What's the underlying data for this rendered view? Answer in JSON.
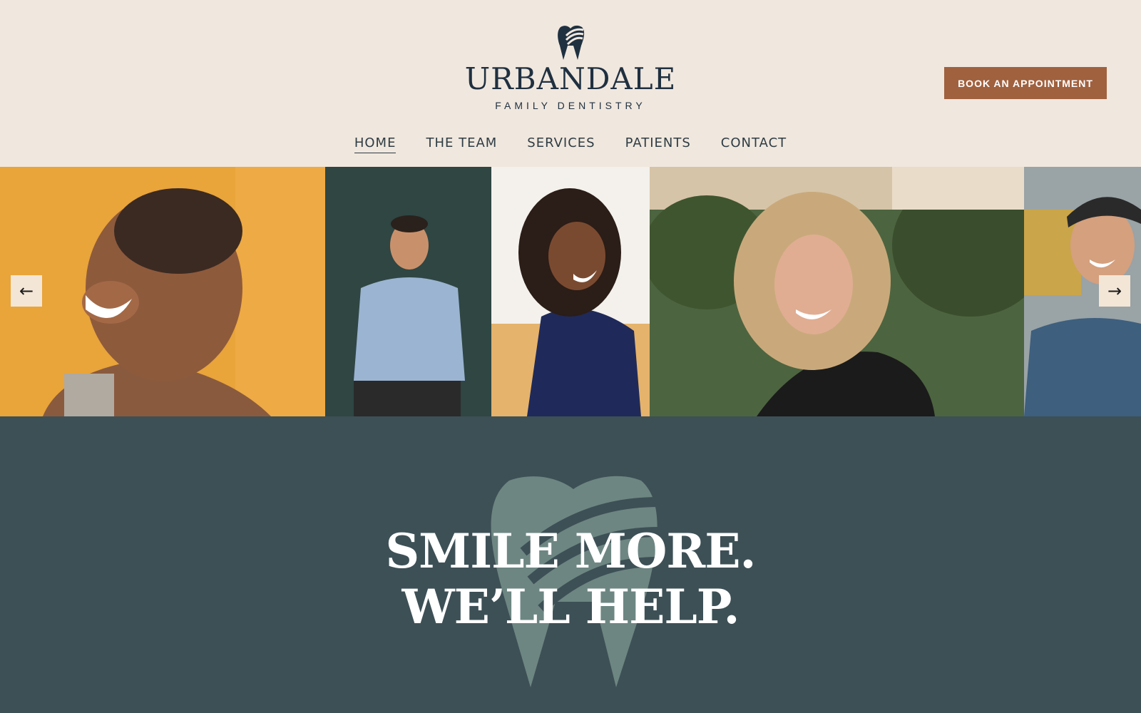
{
  "brand": {
    "name": "URBANDALE",
    "tagline": "FAMILY DENTISTRY"
  },
  "header": {
    "cta_label": "BOOK AN APPOINTMENT"
  },
  "nav": {
    "items": [
      {
        "label": "HOME",
        "active": true
      },
      {
        "label": "THE TEAM",
        "active": false
      },
      {
        "label": "SERVICES",
        "active": false
      },
      {
        "label": "PATIENTS",
        "active": false
      },
      {
        "label": "CONTACT",
        "active": false
      }
    ]
  },
  "gallery": {
    "prev_icon": "←",
    "next_icon": "→"
  },
  "hero": {
    "line1": "SMILE MORE.",
    "line2": "WE’LL HELP."
  },
  "colors": {
    "background": "#f0e7de",
    "brand_navy": "#1f3040",
    "cta": "#a0613f",
    "hero_bg": "#3d5056",
    "hero_tooth": "#6d8682"
  }
}
